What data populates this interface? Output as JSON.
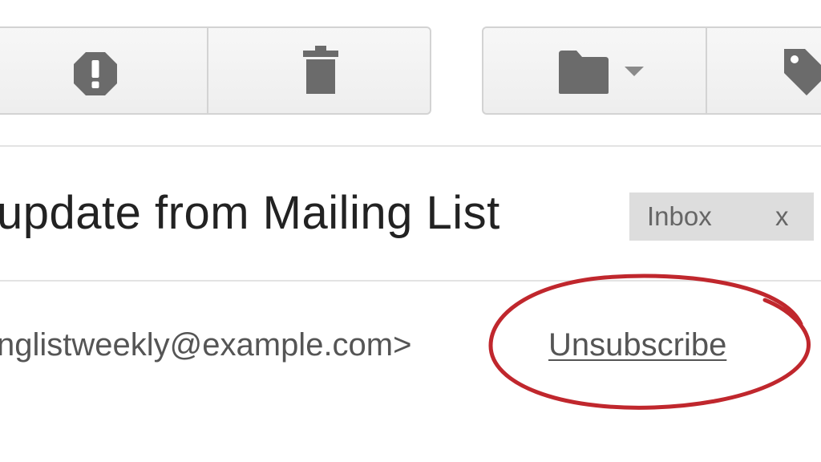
{
  "toolbar": {
    "spam_icon": "report-spam-icon",
    "delete_icon": "trash-icon",
    "move_icon": "folder-icon",
    "move_dropdown_icon": "caret-down-icon",
    "label_icon": "tag-icon",
    "icon_color": "#6b6b6b"
  },
  "message": {
    "subject": "update from Mailing List",
    "label_chip": {
      "label": "Inbox",
      "remove": "x"
    },
    "sender_text": "nglistweekly@example.com>",
    "unsubscribe_label": "Unsubscribe"
  },
  "annotation": {
    "ring_color": "#c0272d"
  }
}
